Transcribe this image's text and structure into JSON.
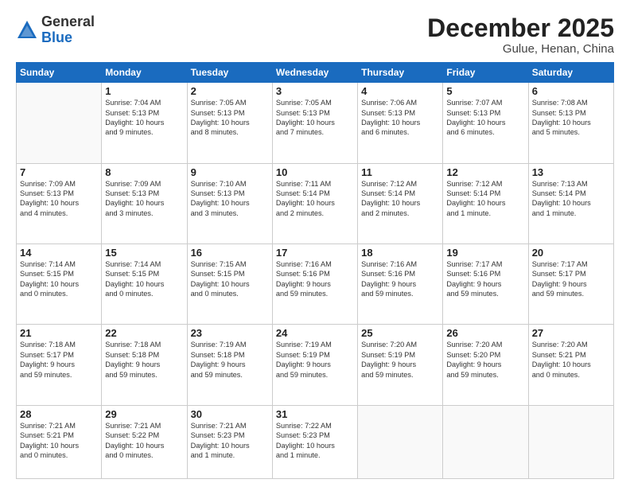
{
  "logo": {
    "general": "General",
    "blue": "Blue"
  },
  "header": {
    "month": "December 2025",
    "location": "Gulue, Henan, China"
  },
  "weekdays": [
    "Sunday",
    "Monday",
    "Tuesday",
    "Wednesday",
    "Thursday",
    "Friday",
    "Saturday"
  ],
  "weeks": [
    [
      {
        "day": "",
        "info": ""
      },
      {
        "day": "1",
        "info": "Sunrise: 7:04 AM\nSunset: 5:13 PM\nDaylight: 10 hours\nand 9 minutes."
      },
      {
        "day": "2",
        "info": "Sunrise: 7:05 AM\nSunset: 5:13 PM\nDaylight: 10 hours\nand 8 minutes."
      },
      {
        "day": "3",
        "info": "Sunrise: 7:05 AM\nSunset: 5:13 PM\nDaylight: 10 hours\nand 7 minutes."
      },
      {
        "day": "4",
        "info": "Sunrise: 7:06 AM\nSunset: 5:13 PM\nDaylight: 10 hours\nand 6 minutes."
      },
      {
        "day": "5",
        "info": "Sunrise: 7:07 AM\nSunset: 5:13 PM\nDaylight: 10 hours\nand 6 minutes."
      },
      {
        "day": "6",
        "info": "Sunrise: 7:08 AM\nSunset: 5:13 PM\nDaylight: 10 hours\nand 5 minutes."
      }
    ],
    [
      {
        "day": "7",
        "info": "Sunrise: 7:09 AM\nSunset: 5:13 PM\nDaylight: 10 hours\nand 4 minutes."
      },
      {
        "day": "8",
        "info": "Sunrise: 7:09 AM\nSunset: 5:13 PM\nDaylight: 10 hours\nand 3 minutes."
      },
      {
        "day": "9",
        "info": "Sunrise: 7:10 AM\nSunset: 5:13 PM\nDaylight: 10 hours\nand 3 minutes."
      },
      {
        "day": "10",
        "info": "Sunrise: 7:11 AM\nSunset: 5:14 PM\nDaylight: 10 hours\nand 2 minutes."
      },
      {
        "day": "11",
        "info": "Sunrise: 7:12 AM\nSunset: 5:14 PM\nDaylight: 10 hours\nand 2 minutes."
      },
      {
        "day": "12",
        "info": "Sunrise: 7:12 AM\nSunset: 5:14 PM\nDaylight: 10 hours\nand 1 minute."
      },
      {
        "day": "13",
        "info": "Sunrise: 7:13 AM\nSunset: 5:14 PM\nDaylight: 10 hours\nand 1 minute."
      }
    ],
    [
      {
        "day": "14",
        "info": "Sunrise: 7:14 AM\nSunset: 5:15 PM\nDaylight: 10 hours\nand 0 minutes."
      },
      {
        "day": "15",
        "info": "Sunrise: 7:14 AM\nSunset: 5:15 PM\nDaylight: 10 hours\nand 0 minutes."
      },
      {
        "day": "16",
        "info": "Sunrise: 7:15 AM\nSunset: 5:15 PM\nDaylight: 10 hours\nand 0 minutes."
      },
      {
        "day": "17",
        "info": "Sunrise: 7:16 AM\nSunset: 5:16 PM\nDaylight: 9 hours\nand 59 minutes."
      },
      {
        "day": "18",
        "info": "Sunrise: 7:16 AM\nSunset: 5:16 PM\nDaylight: 9 hours\nand 59 minutes."
      },
      {
        "day": "19",
        "info": "Sunrise: 7:17 AM\nSunset: 5:16 PM\nDaylight: 9 hours\nand 59 minutes."
      },
      {
        "day": "20",
        "info": "Sunrise: 7:17 AM\nSunset: 5:17 PM\nDaylight: 9 hours\nand 59 minutes."
      }
    ],
    [
      {
        "day": "21",
        "info": "Sunrise: 7:18 AM\nSunset: 5:17 PM\nDaylight: 9 hours\nand 59 minutes."
      },
      {
        "day": "22",
        "info": "Sunrise: 7:18 AM\nSunset: 5:18 PM\nDaylight: 9 hours\nand 59 minutes."
      },
      {
        "day": "23",
        "info": "Sunrise: 7:19 AM\nSunset: 5:18 PM\nDaylight: 9 hours\nand 59 minutes."
      },
      {
        "day": "24",
        "info": "Sunrise: 7:19 AM\nSunset: 5:19 PM\nDaylight: 9 hours\nand 59 minutes."
      },
      {
        "day": "25",
        "info": "Sunrise: 7:20 AM\nSunset: 5:19 PM\nDaylight: 9 hours\nand 59 minutes."
      },
      {
        "day": "26",
        "info": "Sunrise: 7:20 AM\nSunset: 5:20 PM\nDaylight: 9 hours\nand 59 minutes."
      },
      {
        "day": "27",
        "info": "Sunrise: 7:20 AM\nSunset: 5:21 PM\nDaylight: 10 hours\nand 0 minutes."
      }
    ],
    [
      {
        "day": "28",
        "info": "Sunrise: 7:21 AM\nSunset: 5:21 PM\nDaylight: 10 hours\nand 0 minutes."
      },
      {
        "day": "29",
        "info": "Sunrise: 7:21 AM\nSunset: 5:22 PM\nDaylight: 10 hours\nand 0 minutes."
      },
      {
        "day": "30",
        "info": "Sunrise: 7:21 AM\nSunset: 5:23 PM\nDaylight: 10 hours\nand 1 minute."
      },
      {
        "day": "31",
        "info": "Sunrise: 7:22 AM\nSunset: 5:23 PM\nDaylight: 10 hours\nand 1 minute."
      },
      {
        "day": "",
        "info": ""
      },
      {
        "day": "",
        "info": ""
      },
      {
        "day": "",
        "info": ""
      }
    ]
  ]
}
